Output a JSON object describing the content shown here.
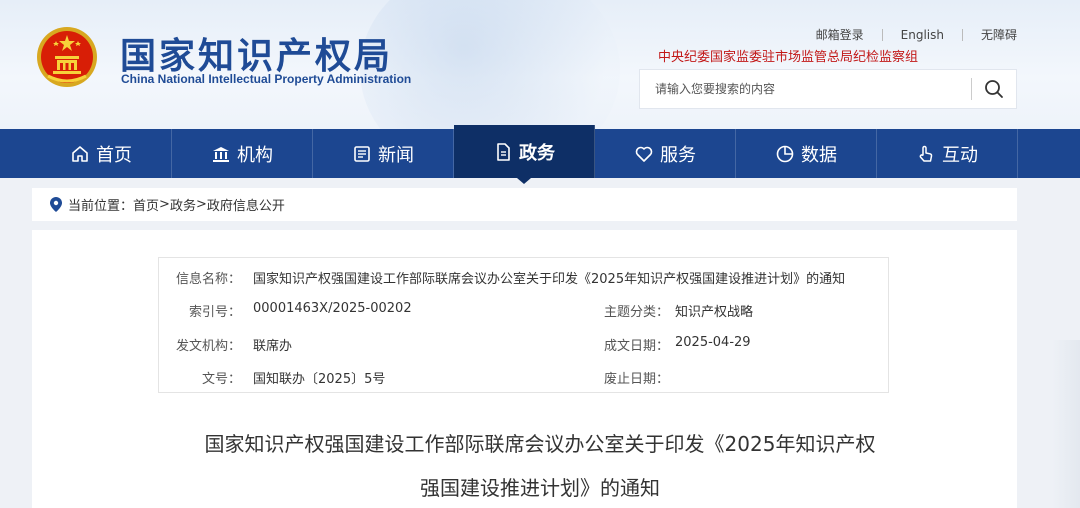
{
  "header": {
    "logo_cn": "国家知识产权局",
    "logo_en": "China National Intellectual Property Administration",
    "links": [
      "邮箱登录",
      "English",
      "无障碍"
    ],
    "discipline": "中央纪委国家监委驻市场监管总局纪检监察组",
    "search_placeholder": "请输入您要搜索的内容"
  },
  "nav": {
    "items": [
      {
        "label": "首页",
        "icon": "home-icon"
      },
      {
        "label": "机构",
        "icon": "institution-icon"
      },
      {
        "label": "新闻",
        "icon": "news-icon"
      },
      {
        "label": "政务",
        "icon": "document-icon",
        "active": true
      },
      {
        "label": "服务",
        "icon": "service-icon"
      },
      {
        "label": "数据",
        "icon": "data-icon"
      },
      {
        "label": "互动",
        "icon": "interaction-icon"
      }
    ]
  },
  "breadcrumb": {
    "prefix": "当前位置：",
    "items": [
      "首页",
      "政务",
      "政府信息公开"
    ],
    "separator": ">"
  },
  "info": {
    "name_label": "信息名称：",
    "name_value": "国家知识产权强国建设工作部际联席会议办公室关于印发《2025年知识产权强国建设推进计划》的通知",
    "index_label": "索引号：",
    "index_value": "00001463X/2025-00202",
    "topic_label": "主题分类：",
    "topic_value": "知识产权战略",
    "issuer_label": "发文机构：",
    "issuer_value": "联席办",
    "date_label": "成文日期：",
    "date_value": "2025-04-29",
    "docno_label": "文号：",
    "docno_value": "国知联办〔2025〕5号",
    "abolish_label": "废止日期：",
    "abolish_value": ""
  },
  "article": {
    "title_line1": "国家知识产权强国建设工作部际联席会议办公室关于印发《2025年知识产权",
    "title_line2": "强国建设推进计划》的通知"
  },
  "colors": {
    "brand": "#1f4b96",
    "nav": "#1c4690",
    "nav_active": "#0e2f66",
    "discipline": "#c21818"
  }
}
